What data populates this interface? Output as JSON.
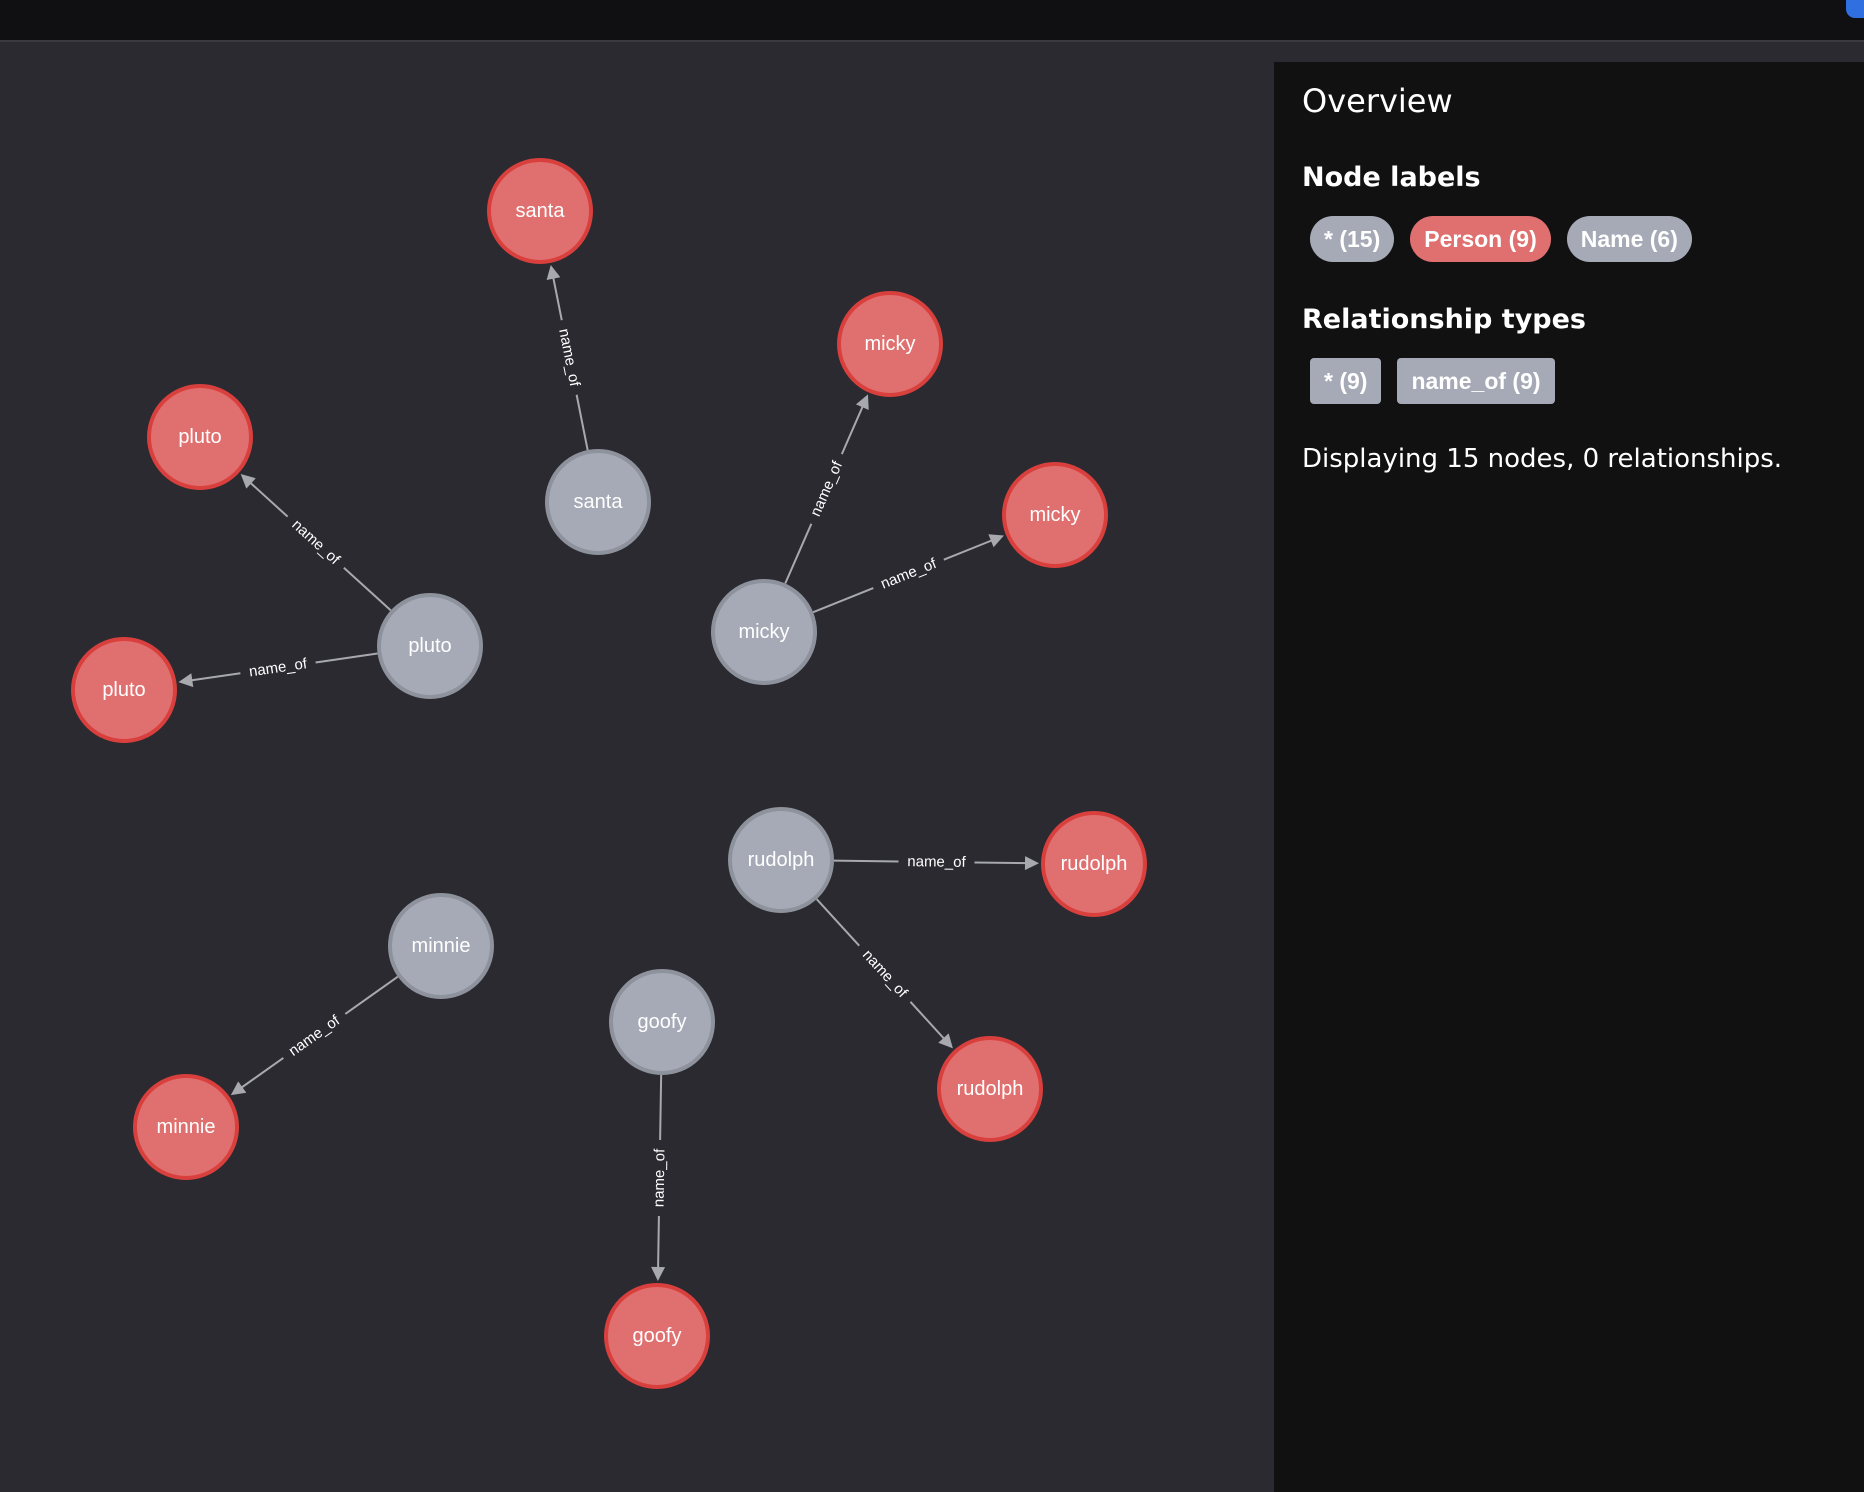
{
  "overview": {
    "title": "Overview",
    "node_labels_title": "Node labels",
    "node_labels": [
      {
        "text": "* (15)",
        "color": "#a5aab6"
      },
      {
        "text": "Person (9)",
        "color": "#e0706f"
      },
      {
        "text": "Name (6)",
        "color": "#a5aab6"
      }
    ],
    "relationship_types_title": "Relationship types",
    "relationship_types": [
      {
        "text": "* (9)",
        "color": "#a5aab6"
      },
      {
        "text": "name_of (9)",
        "color": "#a5aab6"
      }
    ],
    "summary": "Displaying 15 nodes, 0 relationships."
  },
  "graph": {
    "node_colors": {
      "Person": "#e0706f",
      "Name": "#a5aab6"
    },
    "nodes": [
      {
        "id": "n_santa",
        "label": "Name",
        "text": "santa"
      },
      {
        "id": "p_santa",
        "label": "Person",
        "text": "santa"
      },
      {
        "id": "n_pluto",
        "label": "Name",
        "text": "pluto"
      },
      {
        "id": "p_pluto1",
        "label": "Person",
        "text": "pluto"
      },
      {
        "id": "p_pluto2",
        "label": "Person",
        "text": "pluto"
      },
      {
        "id": "n_micky",
        "label": "Name",
        "text": "micky"
      },
      {
        "id": "p_micky1",
        "label": "Person",
        "text": "micky"
      },
      {
        "id": "p_micky2",
        "label": "Person",
        "text": "micky"
      },
      {
        "id": "n_rudolph",
        "label": "Name",
        "text": "rudolph"
      },
      {
        "id": "p_rudolph1",
        "label": "Person",
        "text": "rudolph"
      },
      {
        "id": "p_rudolph2",
        "label": "Person",
        "text": "rudolph"
      },
      {
        "id": "n_minnie",
        "label": "Name",
        "text": "minnie"
      },
      {
        "id": "p_minnie",
        "label": "Person",
        "text": "minnie"
      },
      {
        "id": "n_goofy",
        "label": "Name",
        "text": "goofy"
      },
      {
        "id": "p_goofy",
        "label": "Person",
        "text": "goofy"
      }
    ],
    "edges": [
      {
        "from": "n_santa",
        "to": "p_santa",
        "type": "name_of"
      },
      {
        "from": "n_pluto",
        "to": "p_pluto1",
        "type": "name_of"
      },
      {
        "from": "n_pluto",
        "to": "p_pluto2",
        "type": "name_of"
      },
      {
        "from": "n_micky",
        "to": "p_micky1",
        "type": "name_of"
      },
      {
        "from": "n_micky",
        "to": "p_micky2",
        "type": "name_of"
      },
      {
        "from": "n_rudolph",
        "to": "p_rudolph1",
        "type": "name_of"
      },
      {
        "from": "n_rudolph",
        "to": "p_rudolph2",
        "type": "name_of"
      },
      {
        "from": "n_minnie",
        "to": "p_minnie",
        "type": "name_of"
      },
      {
        "from": "n_goofy",
        "to": "p_goofy",
        "type": "name_of"
      }
    ]
  }
}
